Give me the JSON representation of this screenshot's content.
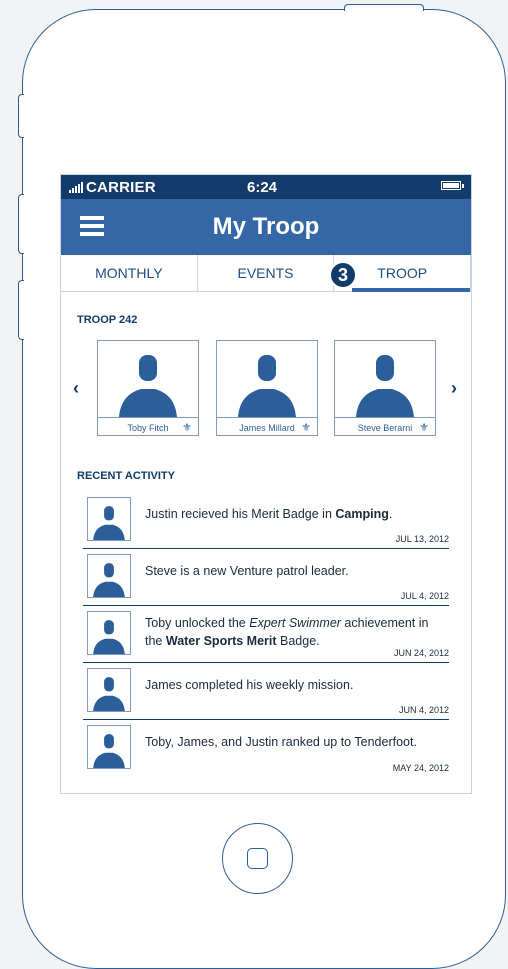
{
  "status_bar": {
    "carrier": "CARRIER",
    "time": "6:24"
  },
  "navbar": {
    "title": "My Troop",
    "menu_icon": "hamburger-menu-icon"
  },
  "tabs": [
    {
      "label": "MONTHLY",
      "active": false
    },
    {
      "label": "EVENTS",
      "active": false
    },
    {
      "label": "TROOP",
      "active": true
    }
  ],
  "step_badge": "3",
  "troop": {
    "title": "TROOP 242",
    "members": [
      {
        "name": "Toby Fitch"
      },
      {
        "name": "James Millard"
      },
      {
        "name": "Steve Berarni"
      }
    ],
    "prev_icon": "chevron-left-icon",
    "next_icon": "chevron-right-icon"
  },
  "recent_activity": {
    "title": "RECENT ACTIVITY",
    "items": [
      {
        "text_before": "Justin recieved his Merit Badge in ",
        "bold1": "Camping",
        "text_after": ".",
        "date": "JUL 13, 2012"
      },
      {
        "text": "Steve is a new Venture patrol leader.",
        "date": "JUL 4, 2012"
      },
      {
        "text_before": "Toby unlocked the ",
        "italic": "Expert Swimmer",
        "text_mid": " achievement in the ",
        "bold1": "Water Sports Merit",
        "text_after": " Badge.",
        "date": "JUN 24, 2012"
      },
      {
        "text": "James completed his weekly mission.",
        "date": "JUN 4, 2012"
      },
      {
        "text": "Toby, James, and Justin ranked up to Tenderfoot.",
        "date": "MAY 24, 2012"
      }
    ]
  },
  "colors": {
    "primary": "#3567a7",
    "dark": "#123a6b",
    "outline": "#2c5f9a"
  }
}
